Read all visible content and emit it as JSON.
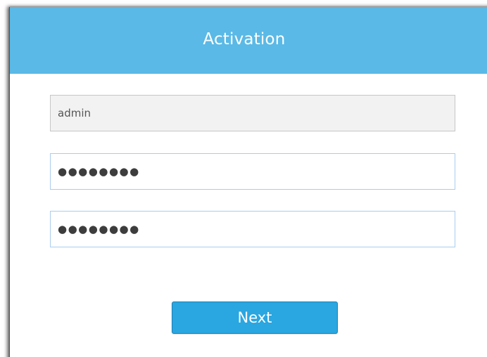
{
  "dialog": {
    "title": "Activation",
    "username_value": "admin",
    "password_value": "●●●●●●●●",
    "confirm_password_value": "●●●●●●●●",
    "next_label": "Next"
  },
  "colors": {
    "header_bg": "#5ab9e6",
    "button_bg": "#2aa6e0",
    "input_border": "#a9cdf0"
  }
}
